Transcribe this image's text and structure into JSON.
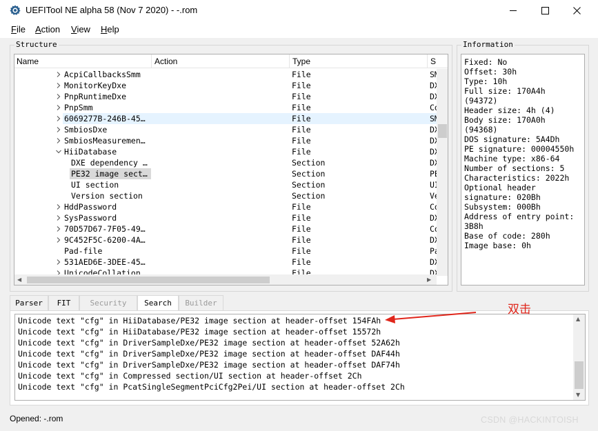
{
  "window": {
    "title": "UEFITool NE alpha 58 (Nov  7 2020) - -.rom"
  },
  "menu": [
    "File",
    "Action",
    "View",
    "Help"
  ],
  "structure": {
    "title": "Structure",
    "columns": [
      "Name",
      "Action",
      "Type",
      "S"
    ],
    "rows": [
      {
        "name": "AcpiCallbacksSmm",
        "action": "",
        "type": "File",
        "s": "SM",
        "expander": "collapsed",
        "level": 0,
        "highlight": ""
      },
      {
        "name": "MonitorKeyDxe",
        "action": "",
        "type": "File",
        "s": "DX",
        "expander": "collapsed",
        "level": 0,
        "highlight": ""
      },
      {
        "name": "PnpRuntimeDxe",
        "action": "",
        "type": "File",
        "s": "DX",
        "expander": "collapsed",
        "level": 0,
        "highlight": ""
      },
      {
        "name": "PnpSmm",
        "action": "",
        "type": "File",
        "s": "Co",
        "expander": "collapsed",
        "level": 0,
        "highlight": ""
      },
      {
        "name": "6069277B-246B-45…",
        "action": "",
        "type": "File",
        "s": "SM",
        "expander": "collapsed",
        "level": 0,
        "highlight": "blue"
      },
      {
        "name": "SmbiosDxe",
        "action": "",
        "type": "File",
        "s": "DX",
        "expander": "collapsed",
        "level": 0,
        "highlight": ""
      },
      {
        "name": "SmbiosMeasuremen…",
        "action": "",
        "type": "File",
        "s": "DX",
        "expander": "collapsed",
        "level": 0,
        "highlight": ""
      },
      {
        "name": "HiiDatabase",
        "action": "",
        "type": "File",
        "s": "DX",
        "expander": "expanded",
        "level": 0,
        "highlight": ""
      },
      {
        "name": "DXE dependency …",
        "action": "",
        "type": "Section",
        "s": "DX",
        "expander": "none",
        "level": 1,
        "highlight": ""
      },
      {
        "name": "PE32 image sect…",
        "action": "",
        "type": "Section",
        "s": "PE",
        "expander": "none",
        "level": 1,
        "highlight": "gray"
      },
      {
        "name": "UI section",
        "action": "",
        "type": "Section",
        "s": "UI",
        "expander": "none",
        "level": 1,
        "highlight": ""
      },
      {
        "name": "Version section",
        "action": "",
        "type": "Section",
        "s": "Ve",
        "expander": "none",
        "level": 1,
        "highlight": ""
      },
      {
        "name": "HddPassword",
        "action": "",
        "type": "File",
        "s": "Co",
        "expander": "collapsed",
        "level": 0,
        "highlight": ""
      },
      {
        "name": "SysPassword",
        "action": "",
        "type": "File",
        "s": "DX",
        "expander": "collapsed",
        "level": 0,
        "highlight": ""
      },
      {
        "name": "70D57D67-7F05-49…",
        "action": "",
        "type": "File",
        "s": "Co",
        "expander": "collapsed",
        "level": 0,
        "highlight": ""
      },
      {
        "name": "9C452F5C-6200-4A…",
        "action": "",
        "type": "File",
        "s": "DX",
        "expander": "collapsed",
        "level": 0,
        "highlight": ""
      },
      {
        "name": "Pad-file",
        "action": "",
        "type": "File",
        "s": "Pa",
        "expander": "none",
        "level": 0,
        "highlight": ""
      },
      {
        "name": "531AED6E-3DEE-45…",
        "action": "",
        "type": "File",
        "s": "DX",
        "expander": "collapsed",
        "level": 0,
        "highlight": ""
      },
      {
        "name": "UnicodeCollation",
        "action": "",
        "type": "File",
        "s": "DX",
        "expander": "collapsed",
        "level": 0,
        "highlight": ""
      }
    ]
  },
  "information": {
    "title": "Information",
    "lines": [
      "Fixed: No",
      "Offset: 30h",
      "Type: 10h",
      "Full size: 170A4h",
      "(94372)",
      "Header size: 4h (4)",
      "Body size: 170A0h",
      "(94368)",
      "DOS signature: 5A4Dh",
      "PE signature: 00004550h",
      "Machine type: x86-64",
      "Number of sections: 5",
      "Characteristics: 2022h",
      "Optional header",
      "signature: 020Bh",
      "Subsystem: 000Bh",
      "Address of entry point:",
      "3B8h",
      "Base of code: 280h",
      "Image base: 0h"
    ]
  },
  "tabs": [
    {
      "label": "Parser",
      "state": "normal"
    },
    {
      "label": "FIT",
      "state": "normal"
    },
    {
      "label": "Security",
      "state": "disabled"
    },
    {
      "label": "Search",
      "state": "active"
    },
    {
      "label": "Builder",
      "state": "disabled"
    }
  ],
  "search_results": [
    "Unicode text \"cfg\" in HiiDatabase/PE32 image section at header-offset 154FAh",
    "Unicode text \"cfg\" in HiiDatabase/PE32 image section at header-offset 15572h",
    "Unicode text \"cfg\" in DriverSampleDxe/PE32 image section at header-offset 52A62h",
    "Unicode text \"cfg\" in DriverSampleDxe/PE32 image section at header-offset DAF44h",
    "Unicode text \"cfg\" in DriverSampleDxe/PE32 image section at header-offset DAF74h",
    "Unicode text \"cfg\" in Compressed section/UI section at header-offset 2Ch",
    "Unicode text \"cfg\" in PcatSingleSegmentPciCfg2Pei/UI section at header-offset 2Ch"
  ],
  "annotation": {
    "text": "双击",
    "color": "#e0261b"
  },
  "status": {
    "text": "Opened: -.rom"
  },
  "watermark": "CSDN @HACKINTOISH",
  "colors": {
    "row_highlight": "#e5f3ff",
    "row_selected": "#d9d9d9",
    "annotation": "#e0261b"
  }
}
